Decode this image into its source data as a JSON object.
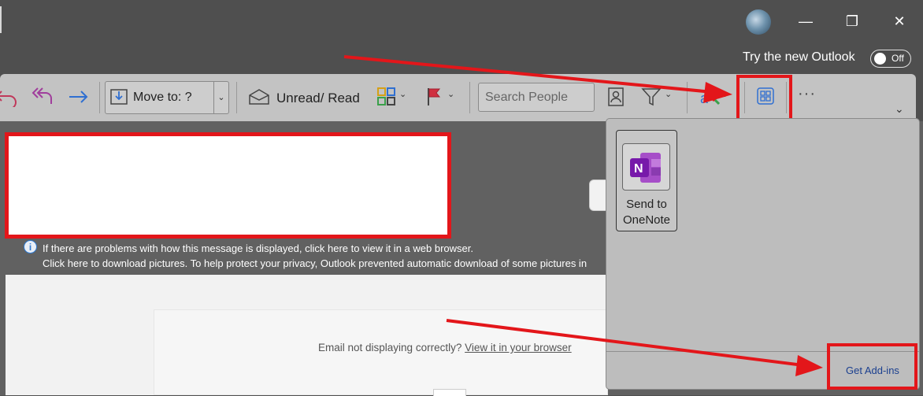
{
  "window": {
    "minimize_glyph": "—",
    "restore_glyph": "❐",
    "close_glyph": "✕"
  },
  "header": {
    "try_new_outlook": "Try the new Outlook",
    "toggle_state": "Off"
  },
  "toolbar": {
    "move_to_label": "Move to: ?",
    "unread_read_label": "Unread/ Read",
    "search_placeholder": "Search People",
    "more_label": "···"
  },
  "message": {
    "info_line1": "If there are problems with how this message is displayed, click here to view it in a web browser.",
    "info_line2": "Click here to download pictures. To help protect your privacy, Outlook prevented automatic download of some pictures in",
    "email_not_displaying": "Email not displaying correctly?",
    "view_in_browser": "View it in your browser"
  },
  "addins_panel": {
    "addin_label": "Send to OneNote",
    "get_addins": "Get Add-ins"
  },
  "colors": {
    "annotation_red": "#e3161a",
    "onenote_purple": "#7719aa",
    "link_blue": "#1a3f8f"
  }
}
